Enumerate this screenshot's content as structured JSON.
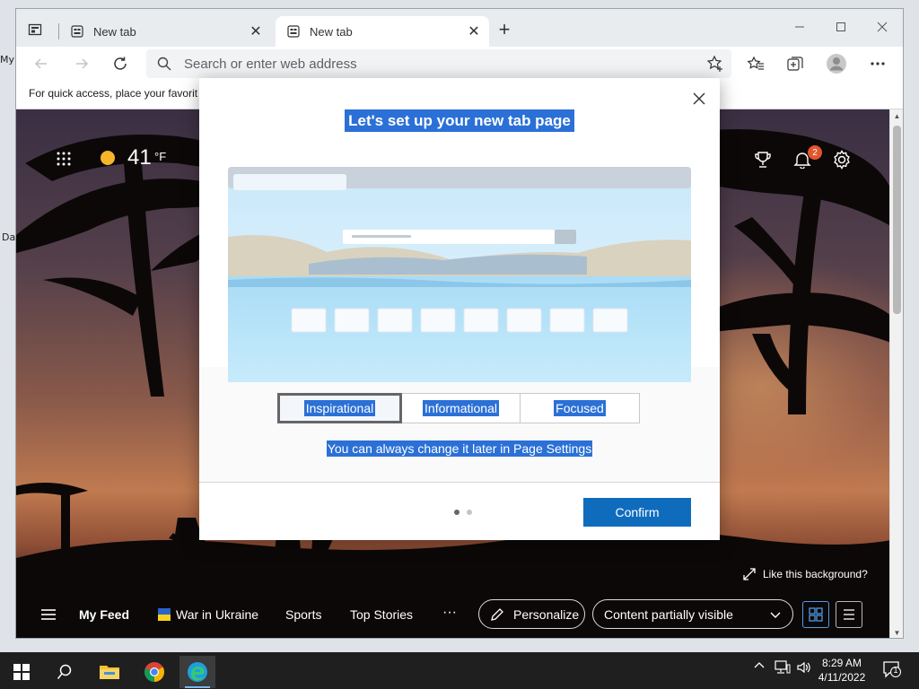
{
  "desktop": {
    "frag_top": "My",
    "frag_bottom": "Da"
  },
  "browser": {
    "tabs": [
      {
        "title": "New tab",
        "active": false
      },
      {
        "title": "New tab",
        "active": true
      }
    ],
    "address_placeholder": "Search or enter web address",
    "favorites_bar_text": "For quick access, place your favorit"
  },
  "ntp": {
    "weather_temp": "41",
    "weather_unit": "°F",
    "notification_count": "2",
    "like_background": "Like this background?",
    "feed": {
      "my_feed": "My Feed",
      "items": [
        "War in Ukraine",
        "Sports",
        "Top Stories"
      ],
      "more": "···",
      "personalize": "Personalize",
      "content_visibility": "Content partially visible"
    }
  },
  "modal": {
    "title": "Let's set up your new tab page",
    "options": [
      "Inspirational",
      "Informational",
      "Focused"
    ],
    "selected_option": "Inspirational",
    "note": "You can always change it later in Page Settings",
    "page_dots": {
      "total": 2,
      "current": 1
    },
    "confirm_label": "Confirm"
  },
  "taskbar": {
    "time": "8:29 AM",
    "date": "4/11/2022",
    "notification_badge": "1"
  },
  "colors": {
    "selection_highlight": "#2b70d6",
    "confirm_button": "#0f6cbd",
    "taskbar": "#1f1f1f",
    "notification_badge": "#e3562d"
  }
}
